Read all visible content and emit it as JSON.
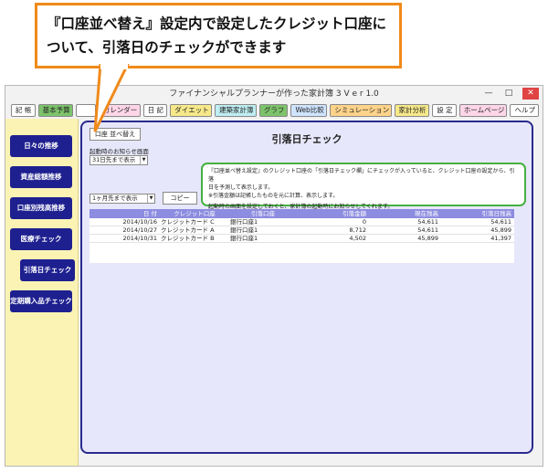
{
  "callout": {
    "line1": "『口座並べ替え』設定内で設定したクレジット口座に",
    "line2": "ついて、引落日のチェックができます"
  },
  "window": {
    "title": "ファイナンシャルプランナーが作った家計簿 3  V e r 1.0",
    "controls": {
      "min": "—",
      "max": "□",
      "close": "✕"
    }
  },
  "tabs": [
    "記 帳",
    "基本予算",
    "",
    "カレンダー",
    "日 記",
    "ダイエット",
    "建築家計簿",
    "グラフ",
    "Web比較",
    "シミュレーション",
    "家計分析",
    "設 定",
    "ホームページ",
    "ヘルプ"
  ],
  "sidebar": {
    "items": [
      "日々の推移",
      "資産総額推移",
      "口座別残高推移",
      "医療チェック",
      "引落日チェック",
      "定期購入品チェック"
    ]
  },
  "main": {
    "title": "引落日チェック",
    "sort_button": "口座 並べ替え",
    "startup_label": "起動時のお知らせ画面",
    "startup_select": "31日先まで表示",
    "range_select": "1ヶ月先まで表示",
    "copy_button": "コピー",
    "notice_lines": [
      "『口座並べ替え設定』のクレジット口座の「引落日チェック欄」にチェックが入っていると、クレジット口座の設定から、引落",
      "日を予測して表示します。",
      "※引落金額は記帳したものを元に計算、表示します。",
      "",
      "起動時の画面を設定しておくと、家計簿の起動時にお知らせしてくれます。"
    ]
  },
  "table": {
    "headers": [
      "日 付",
      "クレジット口座",
      "引落口座",
      "引落金額",
      "現在残高",
      "引落日残高"
    ],
    "rows": [
      [
        "2014/10/16",
        "クレジットカード C",
        "銀行口座1",
        "0",
        "54,611",
        "54,611"
      ],
      [
        "2014/10/27",
        "クレジットカード A",
        "銀行口座1",
        "8,712",
        "54,611",
        "45,899"
      ],
      [
        "2014/10/31",
        "クレジットカード B",
        "銀行口座1",
        "4,502",
        "45,899",
        "41,397"
      ]
    ]
  },
  "colors": {
    "callout_border": "#f08a1a",
    "sidebar_bg": "#fbf3b4",
    "sidebar_button": "#1e2090",
    "main_border": "#2a2a8e",
    "main_bg": "#e7e7fb",
    "notice_border": "#45b040",
    "table_header": "#8c8ce0"
  }
}
